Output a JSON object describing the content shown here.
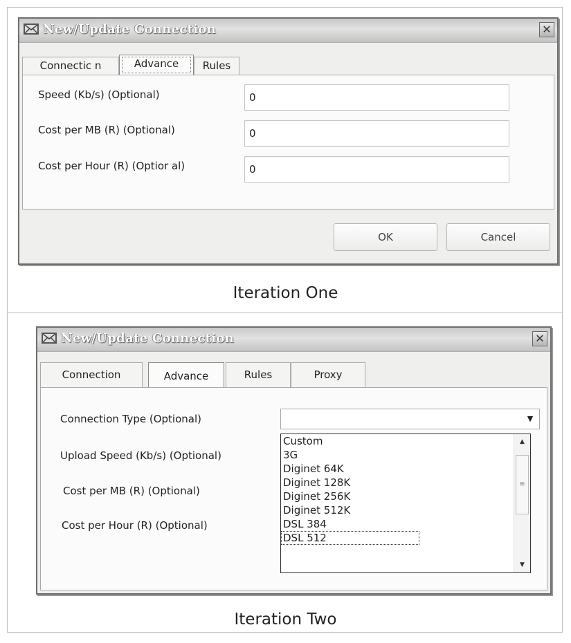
{
  "captions": {
    "one": "Iteration One",
    "two": "Iteration Two"
  },
  "iteration_one": {
    "title": "New/Update Connection",
    "tabs": [
      {
        "label": "Connectic n"
      },
      {
        "label": "Advance"
      },
      {
        "label": "Rules"
      }
    ],
    "fields": [
      {
        "label": "Speed (Kb/s) (Optional)",
        "value": "0"
      },
      {
        "label": "Cost per MB (R) (Optional)",
        "value": "0"
      },
      {
        "label": "Cost per Hour (R) (Optior al)",
        "value": "0"
      }
    ],
    "buttons": {
      "ok": "OK",
      "cancel": "Cancel"
    }
  },
  "iteration_two": {
    "title": "New/Update Connection",
    "tabs": [
      {
        "label": "Connection"
      },
      {
        "label": "Advance"
      },
      {
        "label": "Rules"
      },
      {
        "label": "Proxy"
      }
    ],
    "labels": [
      "Connection Type (Optional)",
      "Upload Speed (Kb/s) (Optional)",
      "Cost per MB (R) (Optional)",
      "Cost per Hour (R) (Optional)"
    ],
    "connection_type_value": "",
    "dropdown_options": [
      "Custom",
      "3G",
      "Diginet 64K",
      "Diginet 128K",
      "Diginet 256K",
      "Diginet 512K",
      "DSL 384",
      "DSL 512"
    ]
  },
  "icons": {
    "title": "envelope-icon",
    "close": "close-icon",
    "dropdown": "chevron-down-icon",
    "scroll_up": "scroll-up-icon",
    "scroll_down": "scroll-down-icon"
  },
  "colors": {
    "title_text": "#ffffff",
    "dialog_bg": "#efefed",
    "panel_bg": "#fbfbfb"
  }
}
